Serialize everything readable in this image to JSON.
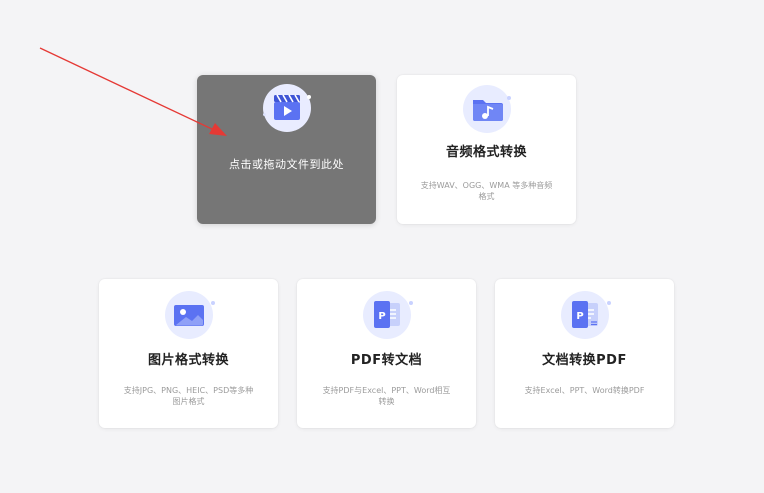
{
  "drop_zone": {
    "label": "点击或拖动文件到此处",
    "icon": "video-clapper-icon",
    "background": "#767676"
  },
  "cards": [
    {
      "title": "音频格式转换",
      "desc": "支持WAV、OGG、WMA 等多种音频格式",
      "icon": "audio-folder-icon"
    },
    {
      "title": "图片格式转换",
      "desc": "支持JPG、PNG、HEIC、PSD等多种图片格式",
      "icon": "image-icon"
    },
    {
      "title": "PDF转文档",
      "desc": "支持PDF与Excel、PPT、Word相互转换",
      "icon": "pdf-to-doc-icon"
    },
    {
      "title": "文档转换PDF",
      "desc": "支持Excel、PPT、Word转换PDF",
      "icon": "doc-to-pdf-icon"
    }
  ],
  "colors": {
    "accent": "#5b72f2",
    "annotation_arrow": "#e53935"
  }
}
